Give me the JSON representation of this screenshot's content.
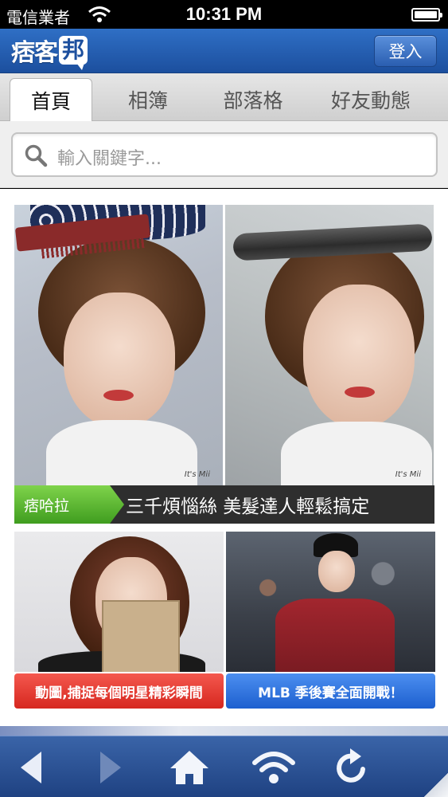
{
  "status_bar": {
    "carrier": "電信業者",
    "time": "10:31 PM",
    "battery_level": 1.0
  },
  "header": {
    "logo_text": "痞客",
    "logo_bubble_char": "邦",
    "login_label": "登入",
    "brand_color": "#1c4f9e"
  },
  "tabs": [
    {
      "label": "首頁",
      "active": true
    },
    {
      "label": "相簿",
      "active": false
    },
    {
      "label": "部落格",
      "active": false
    },
    {
      "label": "好友動態",
      "active": false
    }
  ],
  "search": {
    "placeholder": "輸入關鍵字...",
    "icon": "search-icon"
  },
  "hero": {
    "tag": "痞哈拉",
    "title": "三千煩惱絲 美髮達人輕鬆搞定",
    "watermark": "It's Mii"
  },
  "cards": [
    {
      "caption": "動圖,捕捉每個明星精彩瞬間",
      "color": "#e03a30"
    },
    {
      "caption": "MLB 季後賽全面開戰！",
      "color": "#2f72de"
    }
  ],
  "toolbar": {
    "icons": [
      "back-icon",
      "forward-icon",
      "home-icon",
      "wifi-icon",
      "reload-icon"
    ]
  }
}
